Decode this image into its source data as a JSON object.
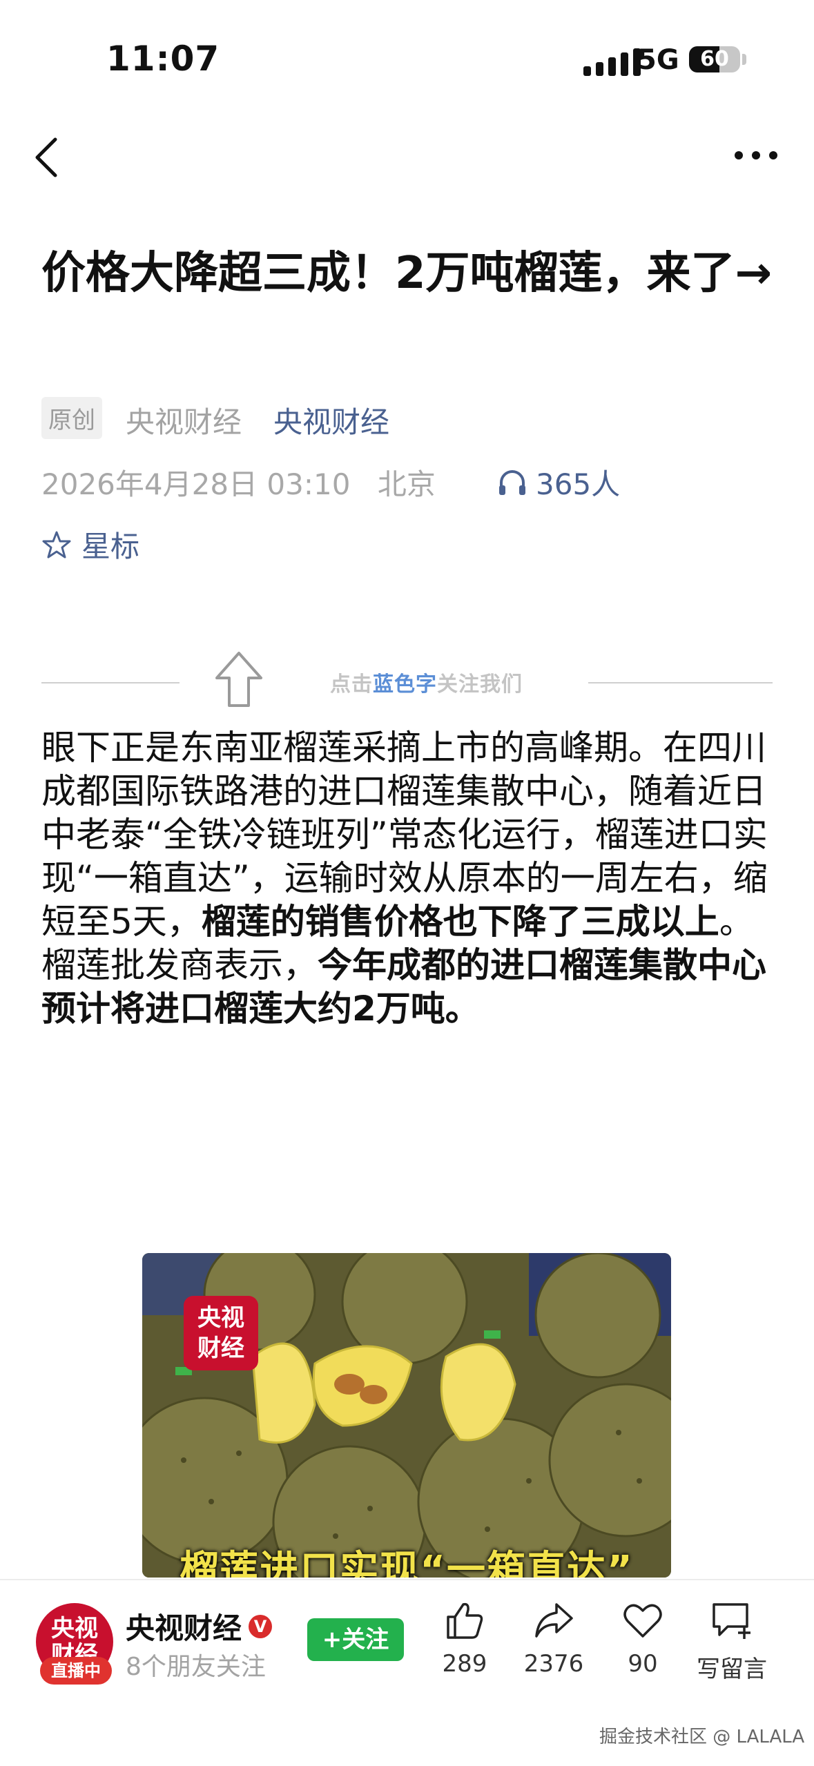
{
  "status_bar": {
    "time": "11:07",
    "network": "5G",
    "battery": "60",
    "battery_level": 0.6
  },
  "nav": {
    "back_icon": "chevron-left-icon",
    "more_icon": "more-horizontal-icon"
  },
  "article": {
    "title": "价格大降超三成！2万吨榴莲，来了→",
    "badge": "原创",
    "source": "央视财经",
    "source_link": "央视财经",
    "date": "2026年4月28日 03:10",
    "location": "北京",
    "listeners": "365人",
    "star_label": "星标",
    "follow_tip_prefix": "点击",
    "follow_tip_blue": "蓝色字",
    "follow_tip_suffix": "关注我们",
    "body_1": "眼下正是东南亚榴莲采摘上市的高峰期。在四川成都国际铁路港的进口榴莲集散中心，随着近日中老泰“全铁冷链班列”常态化运行，榴莲进口实现“一箱直达”，运输时效从原本的一周左右，缩短至5天，",
    "body_bold_1": "榴莲的销售价格也下降了三成以上",
    "body_2": "。榴莲批发商表示，",
    "body_bold_2": "今年成都的进口榴莲集散中心预计将进口榴莲大约2万吨。",
    "image": {
      "logo_line1": "央视",
      "logo_line2": "财经",
      "caption": "榴莲进口实现“一箱直达”"
    }
  },
  "bottom_bar": {
    "avatar_line1": "央视",
    "avatar_line2": "财经",
    "live_label": "直播中",
    "account_name": "央视财经",
    "verified": "V",
    "friends": "8个朋友关注",
    "follow_button": "+关注",
    "like_count": "289",
    "share_count": "2376",
    "favorite_count": "90",
    "comment_label": "写留言"
  },
  "watermark": "掘金技术社区 @ LALALA"
}
